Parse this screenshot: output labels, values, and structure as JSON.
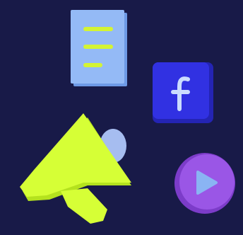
{
  "colors": {
    "background": "#181a48",
    "document_front": "#94baf6",
    "document_back": "#6e9ae6",
    "document_lines": "#d4f434",
    "facebook_tile": "#3131e2",
    "facebook_tile_shadow": "#2424b4",
    "facebook_glyph": "#cbdcff",
    "play_circle": "#9a56e6",
    "play_circle_shadow": "#7c3cc9",
    "play_triangle": "#8ab4f3",
    "megaphone": "#d6ff36",
    "megaphone_shadow": "#b4e21e",
    "megaphone_mouth": "#a6bdf0"
  },
  "icons": [
    "document-icon",
    "facebook-icon",
    "megaphone-icon",
    "play-button-icon"
  ]
}
